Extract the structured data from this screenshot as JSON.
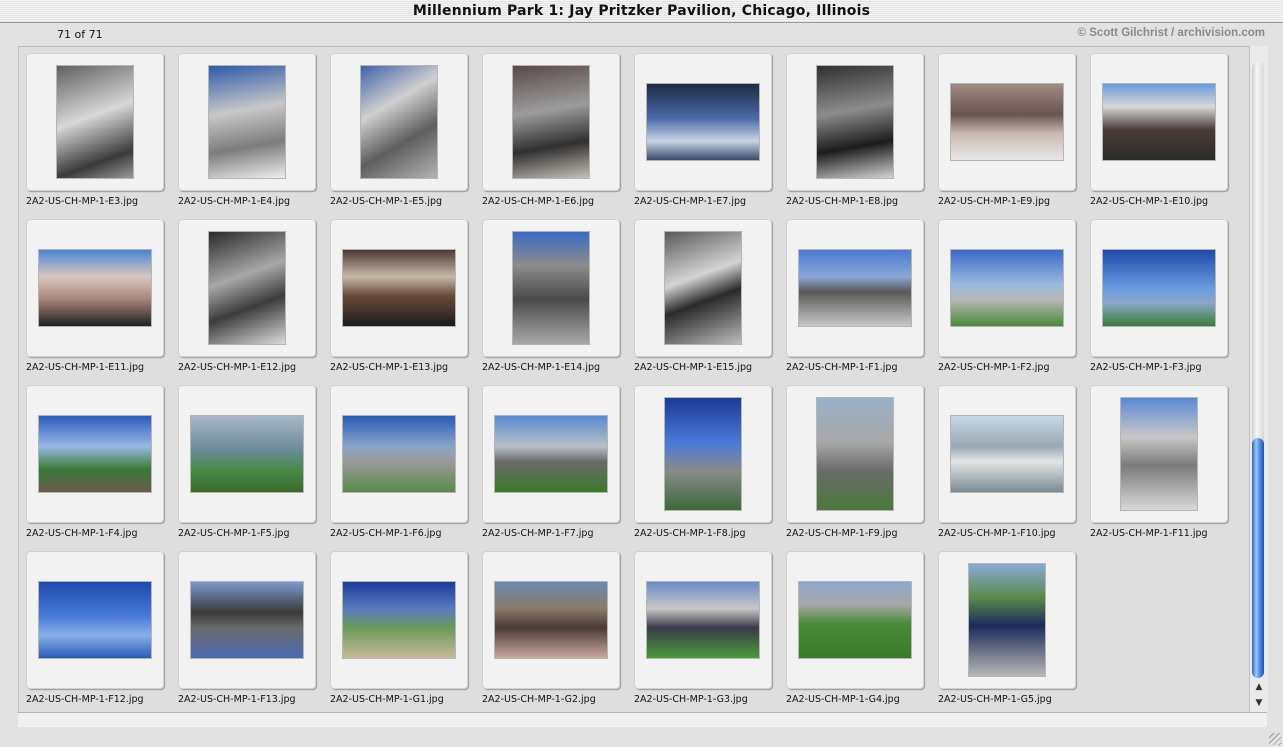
{
  "window": {
    "title": "Millennium Park 1: Jay Pritzker Pavilion, Chicago, Illinois"
  },
  "info": {
    "count": "71 of 71",
    "credit": "© Scott Gilchrist / archivision.com"
  },
  "scrollbar": {
    "up_icon": "arrow-up-icon",
    "down_icon": "arrow-down-icon"
  },
  "colors": {
    "background": "#dedede",
    "slide": "#f2f2f2",
    "scroll_thumb": "#3a74d8"
  },
  "thumbnails": [
    {
      "filename": "2A2-US-CH-MP-1-E3.jpg",
      "orientation": "portrait",
      "bg": "linear-gradient(160deg,#606060,#d8d8d8 45%,#3a3a3a 80%,#9a9a9a)"
    },
    {
      "filename": "2A2-US-CH-MP-1-E4.jpg",
      "orientation": "portrait",
      "bg": "linear-gradient(170deg,#2f5aa8,#c8c8c8 40%,#7c7c7c 70%,#eeeeee)"
    },
    {
      "filename": "2A2-US-CH-MP-1-E5.jpg",
      "orientation": "portrait",
      "bg": "linear-gradient(150deg,#3f62a6,#d0d0d0 35%,#5e5e5e 65%,#b4b4b4)"
    },
    {
      "filename": "2A2-US-CH-MP-1-E6.jpg",
      "orientation": "portrait",
      "bg": "linear-gradient(170deg,#5a4a48,#9c9c9c 40%,#303030 70%,#c8c0b8)"
    },
    {
      "filename": "2A2-US-CH-MP-1-E7.jpg",
      "orientation": "landscape",
      "bg": "linear-gradient(180deg,#1e2a44,#4a6aa8 45%,#c8d4e4 75%,#3a4a6a)"
    },
    {
      "filename": "2A2-US-CH-MP-1-E8.jpg",
      "orientation": "portrait",
      "bg": "linear-gradient(170deg,#303030,#8c8c8c 40%,#1c1c1c 70%,#d4d4d4)"
    },
    {
      "filename": "2A2-US-CH-MP-1-E9.jpg",
      "orientation": "landscape",
      "bg": "linear-gradient(180deg,#a08a84,#6a5450 40%,#c8b8b0 65%,#e8e8e8)"
    },
    {
      "filename": "2A2-US-CH-MP-1-E10.jpg",
      "orientation": "landscape",
      "bg": "linear-gradient(180deg,#6a9adc,#d8d8d8 30%,#4a3c38 60%,#2a2a2a)"
    },
    {
      "filename": "2A2-US-CH-MP-1-E11.jpg",
      "orientation": "landscape",
      "bg": "linear-gradient(180deg,#4a84d4,#d8c8c0 35%,#a88478 65%,#202020)"
    },
    {
      "filename": "2A2-US-CH-MP-1-E12.jpg",
      "orientation": "portrait",
      "bg": "linear-gradient(160deg,#2a2a2a,#a8a8a8 40%,#3c3c3c 65%,#dcdcdc)"
    },
    {
      "filename": "2A2-US-CH-MP-1-E13.jpg",
      "orientation": "landscape",
      "bg": "linear-gradient(180deg,#4a3a34,#c8b8a8 35%,#6a4a3a 60%,#1c1c1c)"
    },
    {
      "filename": "2A2-US-CH-MP-1-E14.jpg",
      "orientation": "portrait",
      "bg": "linear-gradient(180deg,#3a6ac4,#8c8c8c 30%,#4a4a4a 60%,#a8a8a8)"
    },
    {
      "filename": "2A2-US-CH-MP-1-E15.jpg",
      "orientation": "portrait",
      "bg": "linear-gradient(160deg,#5a5a5a,#d4d4d4 40%,#2a2a2a 60%,#bcbcbc)"
    },
    {
      "filename": "2A2-US-CH-MP-1-F1.jpg",
      "orientation": "landscape",
      "bg": "linear-gradient(180deg,#4a7ad0,#8aa8d8 35%,#585858 55%,#c8c8c8)"
    },
    {
      "filename": "2A2-US-CH-MP-1-F2.jpg",
      "orientation": "landscape",
      "bg": "linear-gradient(180deg,#3a6ac8,#9ab8e0 45%,#b8b8b8 65%,#4a8a3a)"
    },
    {
      "filename": "2A2-US-CH-MP-1-F3.jpg",
      "orientation": "landscape",
      "bg": "linear-gradient(180deg,#1c4aa8,#6a9ae0 50%,#8aa8c8 70%,#3a7a3a)"
    },
    {
      "filename": "2A2-US-CH-MP-1-F4.jpg",
      "orientation": "landscape",
      "bg": "linear-gradient(180deg,#2a5ac0,#9ab8e4 40%,#3a7a3a 70%,#6a5a4a)"
    },
    {
      "filename": "2A2-US-CH-MP-1-F5.jpg",
      "orientation": "landscape",
      "bg": "linear-gradient(180deg,#a8b8c8,#6a8a9a 45%,#4a8a4a 70%,#3a6a2a)"
    },
    {
      "filename": "2A2-US-CH-MP-1-F6.jpg",
      "orientation": "landscape",
      "bg": "linear-gradient(180deg,#2a5ab8,#8aa4c8 40%,#9a9a9a 60%,#5a8a4a)"
    },
    {
      "filename": "2A2-US-CH-MP-1-F7.jpg",
      "orientation": "landscape",
      "bg": "linear-gradient(180deg,#5a8ad0,#b8c0c8 40%,#6a6a6a 60%,#3a7a2a)"
    },
    {
      "filename": "2A2-US-CH-MP-1-F8.jpg",
      "orientation": "portrait",
      "bg": "linear-gradient(180deg,#1c3a98,#4a7ad8 40%,#8a8a8a 65%,#3a6a3a)"
    },
    {
      "filename": "2A2-US-CH-MP-1-F9.jpg",
      "orientation": "portrait",
      "bg": "linear-gradient(180deg,#9ab0c8,#a8a8a8 40%,#6a6a6a 65%,#4a7a3a)"
    },
    {
      "filename": "2A2-US-CH-MP-1-F10.jpg",
      "orientation": "landscape",
      "bg": "linear-gradient(180deg,#c8d8e8,#9aa8b4 40%,#e4e4e4 60%,#7a8a94)"
    },
    {
      "filename": "2A2-US-CH-MP-1-F11.jpg",
      "orientation": "portrait",
      "bg": "linear-gradient(180deg,#5a8ad4,#c8c8c8 35%,#7a7a7a 60%,#d8d8d8)"
    },
    {
      "filename": "2A2-US-CH-MP-1-F12.jpg",
      "orientation": "landscape",
      "bg": "linear-gradient(180deg,#1c4ab0,#4a7ad8 45%,#8ab0e8 70%,#2a5ab8)"
    },
    {
      "filename": "2A2-US-CH-MP-1-F13.jpg",
      "orientation": "landscape",
      "bg": "linear-gradient(180deg,#7a9ad0,#3a3a3a 40%,#6a6a6a 60%,#4a6ab0)"
    },
    {
      "filename": "2A2-US-CH-MP-1-G1.jpg",
      "orientation": "landscape",
      "bg": "linear-gradient(180deg,#1c3a98,#5a7ac0 35%,#6a9a5a 60%,#c8b89a)"
    },
    {
      "filename": "2A2-US-CH-MP-1-G2.jpg",
      "orientation": "landscape",
      "bg": "linear-gradient(180deg,#6a8ab0,#8a7a6a 35%,#4a3a34 60%,#c8a8a0)"
    },
    {
      "filename": "2A2-US-CH-MP-1-G3.jpg",
      "orientation": "landscape",
      "bg": "linear-gradient(180deg,#6a8ac8,#c8c8c8 35%,#3a3a4a 60%,#4a9a3a)"
    },
    {
      "filename": "2A2-US-CH-MP-1-G4.jpg",
      "orientation": "landscape",
      "bg": "linear-gradient(180deg,#8aa8d0,#a8a8a8 30%,#4a8a3a 55%,#3a7a2a)"
    },
    {
      "filename": "2A2-US-CH-MP-1-G5.jpg",
      "orientation": "portrait",
      "bg": "linear-gradient(180deg,#8aaad8,#5a8a4a 30%,#1c2a5a 55%,#b8b8b8)"
    }
  ]
}
